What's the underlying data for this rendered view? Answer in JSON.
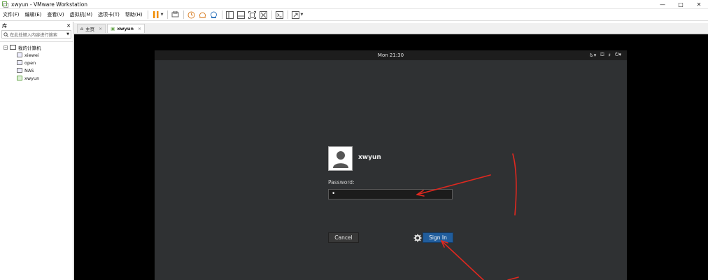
{
  "window": {
    "title": "xwyun - VMware Workstation",
    "minimize": "—",
    "maximize": "□",
    "close": "✕"
  },
  "menubar": {
    "items": [
      "文件(F)",
      "编辑(E)",
      "查看(V)",
      "虚拟机(M)",
      "选项卡(T)",
      "帮助(H)"
    ]
  },
  "library": {
    "title": "库",
    "close": "✕",
    "search_placeholder": "在此处键入内容进行搜索",
    "root": "我的计算机",
    "vms": [
      "xiewei",
      "open",
      "NAS",
      "xwyun"
    ]
  },
  "tabs": [
    {
      "label": "主页",
      "close": "×"
    },
    {
      "label": "xwyun",
      "close": "×"
    }
  ],
  "guest": {
    "clock": "Mon 21:30",
    "username": "xwyun",
    "password_label": "Password:",
    "password_value": "•",
    "cancel_label": "Cancel",
    "signin_label": "Sign In"
  },
  "colors": {
    "signin_bg": "#215d9c",
    "gdm_bg": "#2f3133",
    "annotation": "#e0281f",
    "pause_icon": "#f08c00"
  }
}
